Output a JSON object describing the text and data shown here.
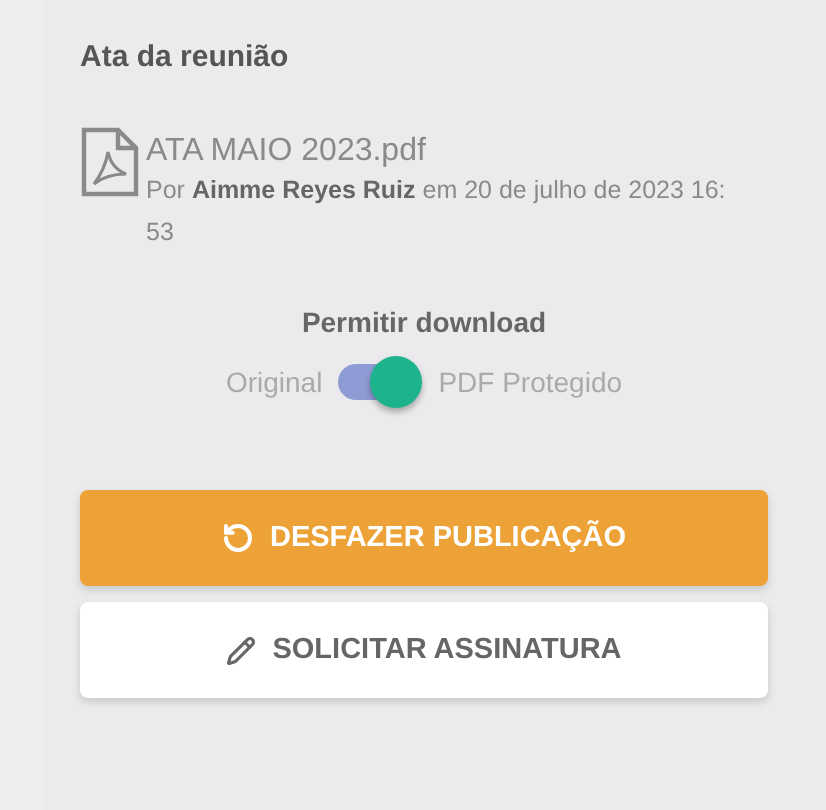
{
  "section_title": "Ata da reunião",
  "file": {
    "name": "ATA MAIO 2023.pdf",
    "meta": "Por **Aimme Reyes Ruiz** em 20 de julho de 2023 16: 53"
  },
  "download": {
    "title": "Permitir download",
    "off_label": "Original",
    "on_label": "PDF Protegido",
    "on": true
  },
  "buttons": [
    {
      "label": "DESFAZER PUBLICAÇÃO",
      "kind": "primary"
    },
    {
      "label": "SOLICITAR ASSINATURA",
      "kind": "secondary"
    }
  ]
}
